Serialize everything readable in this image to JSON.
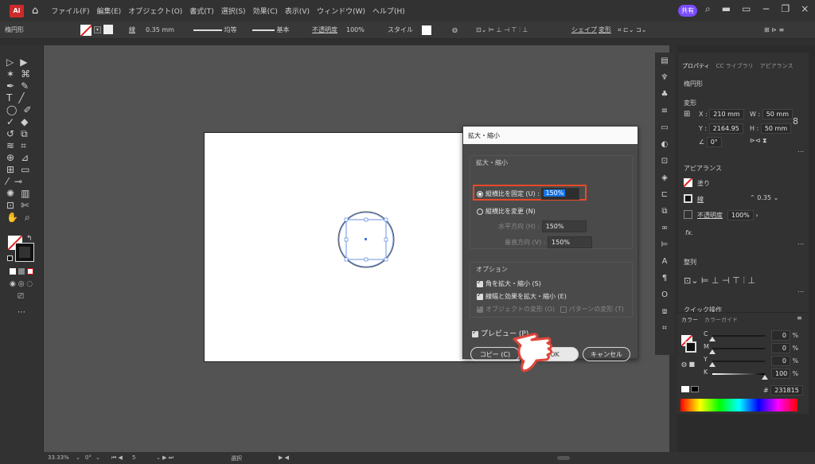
{
  "menubar": {
    "logo": "Ai",
    "items": [
      "ファイル(F)",
      "編集(E)",
      "オブジェクト(O)",
      "書式(T)",
      "選択(S)",
      "効果(C)",
      "表示(V)",
      "ウィンドウ(W)",
      "ヘルプ(H)"
    ],
    "share_label": "共有",
    "win_icons": [
      "search-icon",
      "layout-icon",
      "panel-icon",
      "minimize",
      "restore",
      "close"
    ]
  },
  "controlbar": {
    "object_type": "楕円形",
    "stroke_label": "線",
    "stroke_weight": "0.35 mm",
    "uniform_label": "均等",
    "basic_label": "基本",
    "opacity_label": "不透明度",
    "opacity_value": "100%",
    "style_label": "スタイル",
    "shape_label": "シェイプ",
    "transform_label": "変形"
  },
  "dialog": {
    "title": "拡大・縮小",
    "scale_group": "拡大・縮小",
    "uniform_label": "縦横比を固定 (U) :",
    "uniform_value": "150%",
    "non_uniform_label": "縦横比を変更 (N)",
    "horizontal_label": "水平方向 (H) :",
    "horizontal_value": "150%",
    "vertical_label": "垂直方向 (V) :",
    "vertical_value": "150%",
    "options_group": "オプション",
    "opt_corners": "角を拡大・縮小 (S)",
    "opt_strokes": "線幅と効果を拡大・縮小 (E)",
    "opt_objects": "オブジェクトの変形 (O)",
    "opt_patterns": "パターンの変形 (T)",
    "preview_label": "プレビュー (P)",
    "copy_button": "コピー (C)",
    "ok_button": "OK",
    "cancel_button": "キャンセル"
  },
  "properties": {
    "tabs": [
      "プロパティ",
      "CC ライブラリ",
      "アピアランス"
    ],
    "object_type": "楕円形",
    "transform_label": "変形",
    "x_label": "X :",
    "x_value": "210 mm",
    "w_label": "W :",
    "w_value": "50 mm",
    "y_label": "Y :",
    "y_value": "2164.95",
    "h_label": "H :",
    "h_value": "50 mm",
    "angle_value": "0°",
    "appearance_label": "アピアランス",
    "fill_label": "塗り",
    "stroke_label": "線",
    "stroke_value": "0.35",
    "opacity_label": "不透明度",
    "opacity_value": "100%",
    "fx_label": "fx.",
    "align_label": "整列",
    "quick_actions": "クイック操作"
  },
  "color_panel": {
    "tabs": [
      "カラー",
      "カラーガイド"
    ],
    "c_label": "C",
    "c_value": "0",
    "m_label": "M",
    "m_value": "0",
    "y_label": "Y",
    "y_value": "0",
    "k_label": "K",
    "k_value": "100",
    "percent": "%",
    "hex_value": "231815"
  },
  "statusbar": {
    "zoom": "33.33%",
    "rotation": "0°",
    "artboard_num": "5",
    "tool_name": "選択"
  }
}
